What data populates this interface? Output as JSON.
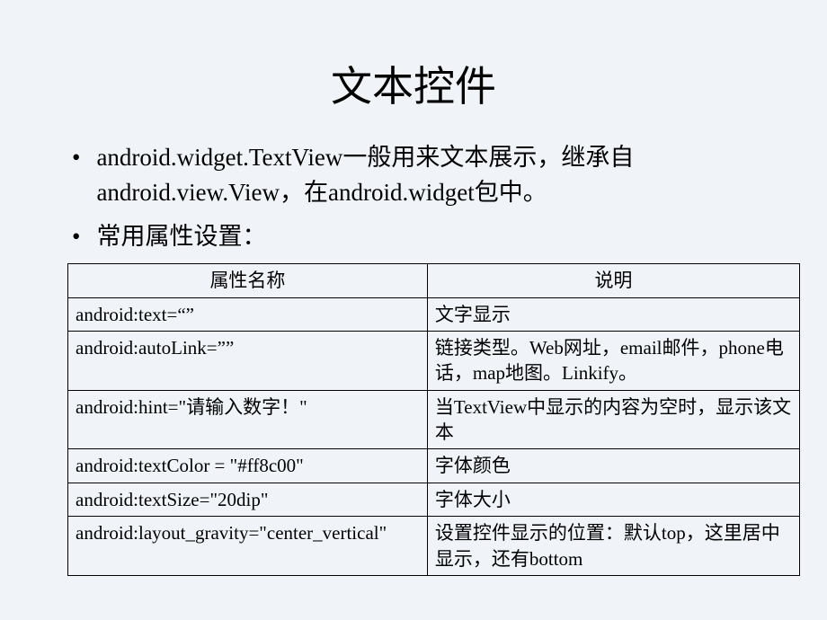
{
  "title": "文本控件",
  "bullets": [
    "android.widget.TextView一般用来文本展示，继承自android.view.View，在android.widget包中。",
    "常用属性设置："
  ],
  "table": {
    "headers": [
      "属性名称",
      "说明"
    ],
    "rows": [
      {
        "attr": "android:text=“”",
        "desc": "文字显示"
      },
      {
        "attr": "android:autoLink=””",
        "desc": "链接类型。Web网址，email邮件，phone电话，map地图。Linkify。"
      },
      {
        "attr": "android:hint=\"请输入数字！\"",
        "desc": "当TextView中显示的内容为空时，显示该文本"
      },
      {
        "attr": "android:textColor = \"#ff8c00\"",
        "desc": "字体颜色"
      },
      {
        "attr": "android:textSize=\"20dip\"",
        "desc": "字体大小"
      },
      {
        "attr": "android:layout_gravity=\"center_vertical\"",
        "desc": "设置控件显示的位置：默认top，这里居中显示，还有bottom"
      }
    ]
  }
}
